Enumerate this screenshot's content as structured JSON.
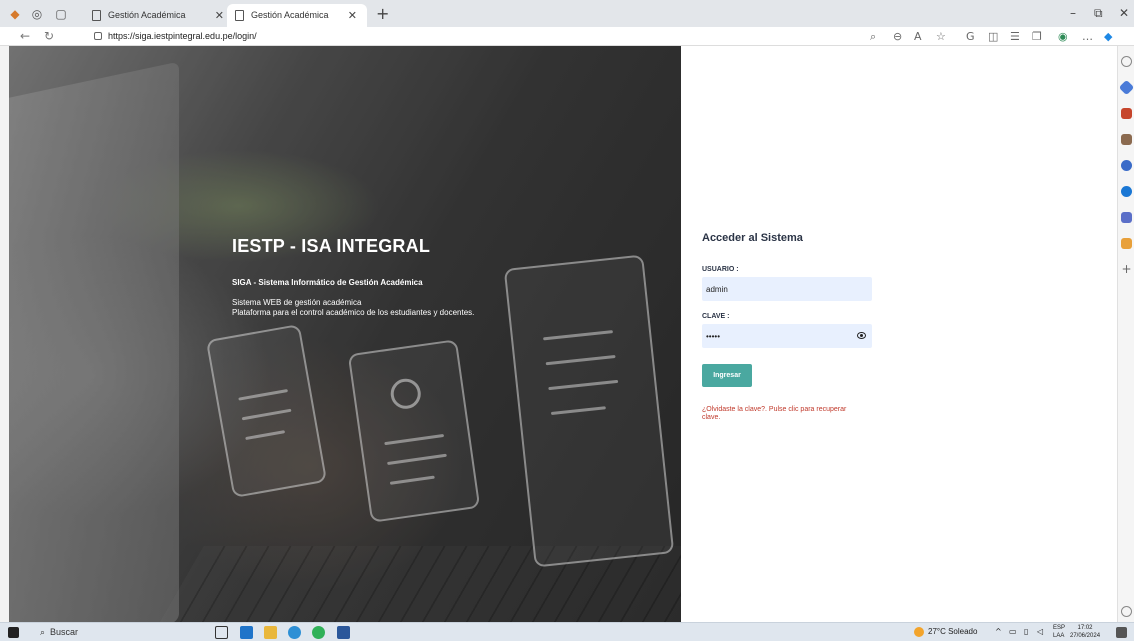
{
  "browser": {
    "tabs": [
      {
        "label": "Gestión Académica",
        "active": false
      },
      {
        "label": "Gestión Académica",
        "active": true
      }
    ],
    "url": "https://siga.iestpintegral.edu.pe/login/",
    "icons": [
      "edge-icon",
      "history-icon",
      "tabs-icon",
      "back-icon",
      "refresh-icon",
      "lock-icon",
      "search-page-icon",
      "zoom-icon",
      "read-aloud-icon",
      "favorite-icon",
      "copilot-icon",
      "split-icon",
      "favorites-icon",
      "collections-icon",
      "extensions-icon",
      "more-icon"
    ]
  },
  "hero": {
    "title": "IESTP - ISA INTEGRAL",
    "subtitle": "SIGA - Sistema Informático de Gestión Académica",
    "desc_line1": "Sistema WEB de gestión académica",
    "desc_line2": "Plataforma para el control académico de los estudiantes y docentes."
  },
  "login": {
    "title": "Acceder al Sistema",
    "user_label": "USUARIO :",
    "user_value": "admin",
    "pass_label": "CLAVE :",
    "pass_value": "•••••",
    "button": "Ingresar",
    "forgot": "¿Olvidaste la clave?. Pulse clic para recuperar clave."
  },
  "taskbar": {
    "search": "Buscar",
    "weather": "27°C  Soleado",
    "lang_line1": "ESP",
    "lang_line2": "LAA",
    "time": "17:02",
    "date": "27/06/2024"
  },
  "colors": {
    "accent": "#4aa8a0",
    "link": "#c0392b",
    "field_bg": "#e8f0fe",
    "title_dark": "#2b3446"
  }
}
